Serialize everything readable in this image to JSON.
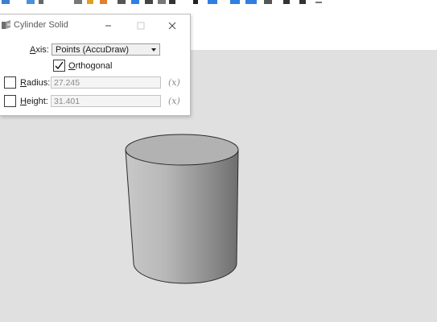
{
  "dialog": {
    "title": "Cylinder Solid",
    "axis": {
      "label_prefix": "",
      "label_key": "A",
      "label_rest": "xis:",
      "value": "Points (AccuDraw)"
    },
    "orthogonal": {
      "label_key": "O",
      "label_rest": "rthogonal",
      "checked": true
    },
    "radius": {
      "label_key": "R",
      "label_rest": "adius:",
      "value": "27.245",
      "locked": false,
      "fx": "(x)"
    },
    "height": {
      "label_key": "H",
      "label_rest": "eight:",
      "value": "31.401",
      "locked": false,
      "fx": "(x)"
    }
  },
  "icons": [
    "cylinder-tool-icon",
    "minimize-icon",
    "maximize-icon",
    "close-icon",
    "chevron-down-icon",
    "checkmark-icon"
  ],
  "colors": {
    "canvas": "#e0e0e0",
    "dialog_bg": "#ffffff",
    "field_bg": "#f4f4f4"
  }
}
